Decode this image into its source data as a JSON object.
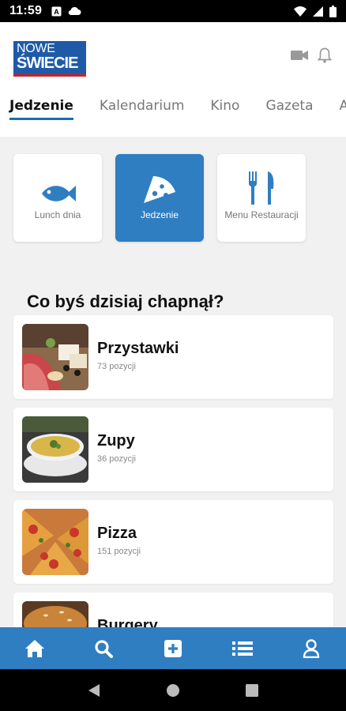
{
  "status_bar": {
    "time": "11:59"
  },
  "header": {
    "logo_line1": "NOWE",
    "logo_line2": "ŚWIECIE"
  },
  "tabs": [
    {
      "label": "Jedzenie",
      "active": true
    },
    {
      "label": "Kalendarium"
    },
    {
      "label": "Kino"
    },
    {
      "label": "Gazeta"
    },
    {
      "label": "Au"
    }
  ],
  "categories": [
    {
      "label": "Lunch dnia",
      "icon": "fish-icon"
    },
    {
      "label": "Jedzenie",
      "icon": "pizza-slice-icon",
      "active": true
    },
    {
      "label": "Menu Restauracji",
      "icon": "utensils-icon"
    }
  ],
  "section_title": "Co byś dzisiaj chapnął?",
  "food_list": [
    {
      "name": "Przystawki",
      "count": "73 pozycji"
    },
    {
      "name": "Zupy",
      "count": "36 pozycji"
    },
    {
      "name": "Pizza",
      "count": "151 pozycji"
    },
    {
      "name": "Burgery",
      "count": ""
    }
  ],
  "bottom_nav": [
    {
      "icon": "home-icon"
    },
    {
      "icon": "search-icon"
    },
    {
      "icon": "plus-square-icon"
    },
    {
      "icon": "list-icon"
    },
    {
      "icon": "user-icon"
    }
  ],
  "colors": {
    "accent": "#2f7ec2",
    "logo_blue": "#1e5aa8",
    "logo_red": "#d32020"
  }
}
